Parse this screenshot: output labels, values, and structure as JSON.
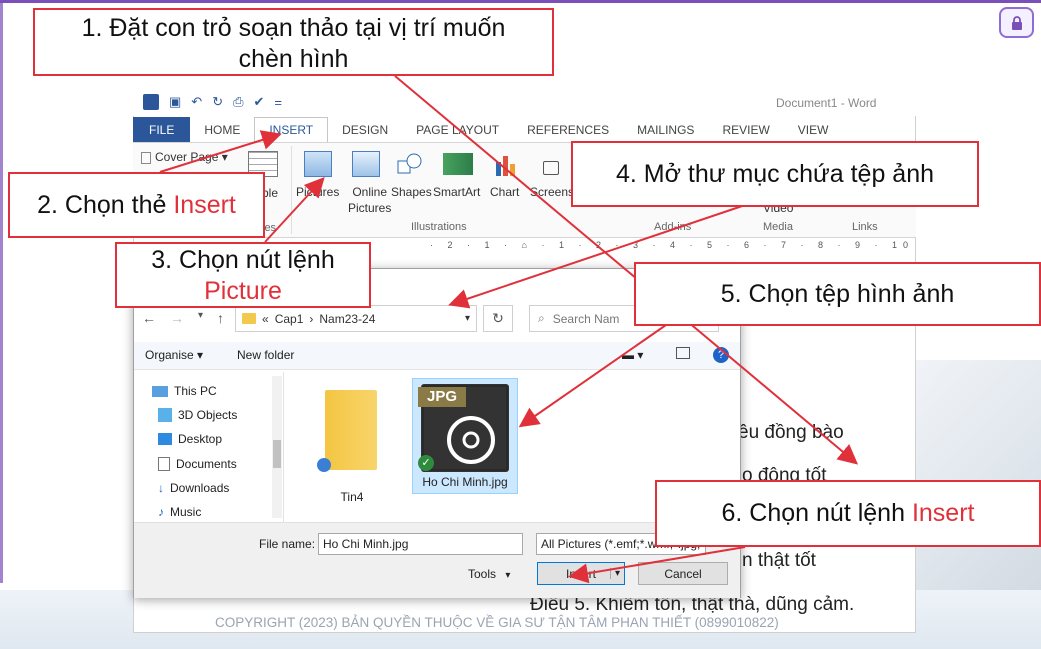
{
  "callouts": {
    "c1_line1": "1. Đặt con trỏ soạn thảo tại vị trí muốn",
    "c1_line2": "chèn hình",
    "c2_text": "2. Chọn thẻ ",
    "c2_red": "Insert",
    "c3_line1": "3. Chọn nút lệnh",
    "c3_red": "Picture",
    "c4_text": "4. Mở thư mục chứa tệp ảnh",
    "c5_text": "5. Chọn tệp hình ảnh",
    "c6_text": "6. Chọn nút lệnh ",
    "c6_red": "Insert"
  },
  "word": {
    "doc_title": "Document1 - Word",
    "tabs": [
      "FILE",
      "HOME",
      "INSERT",
      "DESIGN",
      "PAGE LAYOUT",
      "REFERENCES",
      "MAILINGS",
      "REVIEW",
      "VIEW"
    ],
    "cover_page": "Cover Page",
    "table_partial": "ble",
    "tables_partial": "les",
    "pictures": "Pictures",
    "online": "Online",
    "online_pictures": "Pictures",
    "shapes": "Shapes",
    "smartart": "SmartArt",
    "chart": "Chart",
    "screenshot_partial": "Screens",
    "illustrations": "Illustrations",
    "addins": "Add-ins",
    "video": "Video",
    "media": "Media",
    "links": "Links",
    "ruler": "· 2 · 1 · ⌂ · 1 · 2 · 3 · 4 · 5 · 6 · 7 · 8 · 9 · 10"
  },
  "doc_body": {
    "line1": "êu đồng bào",
    "line2": "o động tốt",
    "line3": "n thật tốt",
    "line4": "Điều 5. Khiêm tốn, thật thà, dũng cảm."
  },
  "dialog": {
    "path_prefix": "«",
    "path_1": "Cap1",
    "path_sep": "›",
    "path_2": "Nam23-24",
    "search_placeholder": "Search Nam",
    "organise": "Organise ▾",
    "new_folder": "New folder",
    "nav_items": [
      "This PC",
      "3D Objects",
      "Desktop",
      "Documents",
      "Downloads",
      "Music"
    ],
    "files": [
      {
        "name": "Tin4",
        "type": "folder"
      },
      {
        "name": "Ho Chi Minh.jpg",
        "type": "jpg",
        "badge": "JPG"
      }
    ],
    "filename_label": "File name:",
    "filename_value": "Ho Chi Minh.jpg",
    "filter_value": "All Pictures (*.emf;*.wmf;*.jpg;",
    "tools": "Tools",
    "insert": "Insert",
    "cancel": "Cancel"
  },
  "copyright": "COPYRIGHT (2023) BẢN QUYỀN THUỘC VỀ GIA SƯ TẬN TÂM PHAN THIẾT (0899010822)",
  "colors": {
    "callout_border": "#e0313b",
    "accent_purple": "#7b4fb8",
    "word_blue": "#2b579a"
  }
}
